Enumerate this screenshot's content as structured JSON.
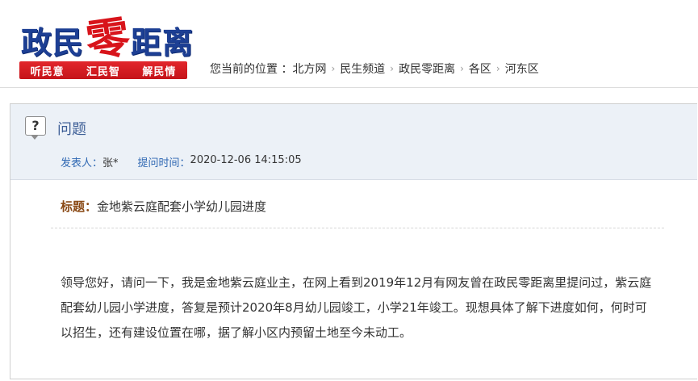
{
  "logo": {
    "word_left": "政民",
    "word_zero": "零",
    "word_right": "距离",
    "slogans": [
      "听民意",
      "汇民智",
      "解民情"
    ]
  },
  "breadcrumb": {
    "label": "您当前的位置 ：",
    "items": [
      "北方网",
      "民生频道",
      "政民零距离",
      "各区",
      "河东区"
    ],
    "separator": "›"
  },
  "question": {
    "section_title": "问题",
    "icon": "question-bubble-icon",
    "poster_label": "发表人：",
    "poster_value": "张*",
    "time_label": "提问时间：",
    "time_value": "2020-12-06 14:15:05",
    "subject_label": "标题：",
    "subject_value": "金地紫云庭配套小学幼儿园进度",
    "body": "领导您好，请问一下，我是金地紫云庭业主，在网上看到2019年12月有网友曾在政民零距离里提问过，紫云庭配套幼儿园小学进度，答复是预计2020年8月幼儿园竣工，小学21年竣工。现想具体了解下进度如何，何时可以招生，还有建设位置在哪，据了解小区内预留土地至今未动工。"
  },
  "colors": {
    "brand_blue": "#1d3f94",
    "brand_red": "#d8141b",
    "panel_bg": "#ecf1f7",
    "label_blue": "#2f68b3"
  }
}
